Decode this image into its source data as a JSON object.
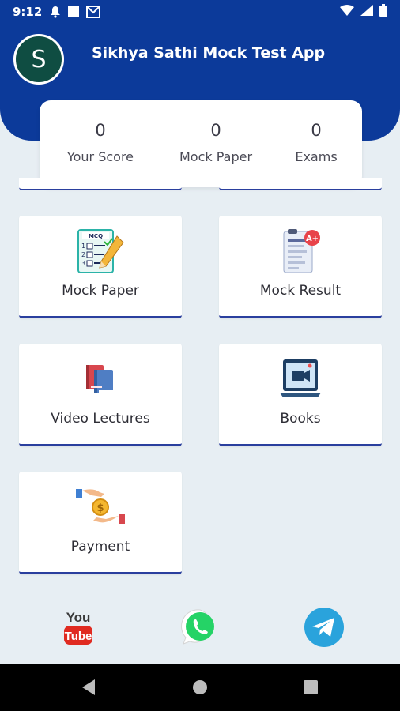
{
  "status_bar": {
    "time": "9:12",
    "icons": [
      "notification-bell-icon",
      "square-icon",
      "gmail-icon",
      "wifi-icon",
      "signal-icon",
      "battery-icon"
    ]
  },
  "header": {
    "avatar_letter": "S",
    "title": "Sikhya Sathi Mock Test App"
  },
  "stats": [
    {
      "value": "0",
      "label": "Your Score"
    },
    {
      "value": "0",
      "label": "Mock Paper"
    },
    {
      "value": "0",
      "label": "Exams"
    }
  ],
  "tiles": [
    {
      "label": "Mock Paper",
      "icon": "mcq-paper-icon"
    },
    {
      "label": "Mock Result",
      "icon": "result-report-icon"
    },
    {
      "label": "Video Lectures",
      "icon": "books-stack-icon"
    },
    {
      "label": "Books",
      "icon": "video-laptop-icon"
    },
    {
      "label": "Payment",
      "icon": "payment-coin-icon"
    }
  ],
  "mcq_icon_text": "MCQ",
  "result_badge": "A+",
  "social": {
    "youtube_you": "You",
    "youtube_tube": "Tube"
  },
  "colors": {
    "brand_blue": "#0c3a9a",
    "avatar_green": "#0f4d42",
    "background": "#e7eef3",
    "whatsapp": "#25d366",
    "telegram": "#2aa3dc",
    "youtube": "#e02a20"
  }
}
